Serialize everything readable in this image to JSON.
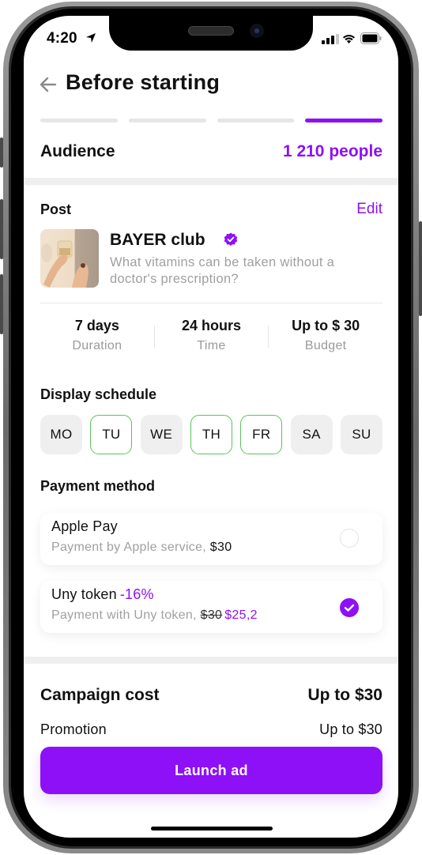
{
  "status_bar": {
    "time": "4:20",
    "icons": [
      "location-arrow-icon",
      "cellular-signal-icon",
      "wifi-icon",
      "battery-icon"
    ]
  },
  "header": {
    "back_icon": "arrow-left-icon",
    "title": "Before starting"
  },
  "steps": {
    "total": 4,
    "current": 4
  },
  "audience": {
    "label": "Audience",
    "value": "1 210 people"
  },
  "post": {
    "label": "Post",
    "edit_label": "Edit",
    "author": "BAYER club",
    "verified": true,
    "text": "What vitamins can be taken without a doctor's prescription?"
  },
  "stats": [
    {
      "value": "7 days",
      "label": "Duration"
    },
    {
      "value": "24 hours",
      "label": "Time"
    },
    {
      "value": "Up to $ 30",
      "label": "Budget"
    }
  ],
  "schedule": {
    "label": "Display schedule",
    "days": [
      {
        "label": "MO",
        "selected": false
      },
      {
        "label": "TU",
        "selected": true
      },
      {
        "label": "WE",
        "selected": false
      },
      {
        "label": "TH",
        "selected": true
      },
      {
        "label": "FR",
        "selected": true
      },
      {
        "label": "SA",
        "selected": false
      },
      {
        "label": "SU",
        "selected": false
      }
    ]
  },
  "payment": {
    "label": "Payment method",
    "options": [
      {
        "title": "Apple Pay",
        "subtitle": "Payment by Apple service, ",
        "price": "$30",
        "selected": false
      },
      {
        "title": "Uny token",
        "discount": "-16%",
        "subtitle": "Payment with Uny token, ",
        "old_price": "$30",
        "new_price": "$25,2",
        "selected": true
      }
    ]
  },
  "cost": {
    "label": "Campaign cost",
    "value": "Up to $30",
    "promotion_label": "Promotion",
    "promotion_value": "Up to $30"
  },
  "launch_button": {
    "label": "Launch ad"
  },
  "colors": {
    "accent": "#8d10f7",
    "selected_day_border": "#5cc25a",
    "muted_text": "#a0a0a0",
    "band": "#efefef"
  }
}
